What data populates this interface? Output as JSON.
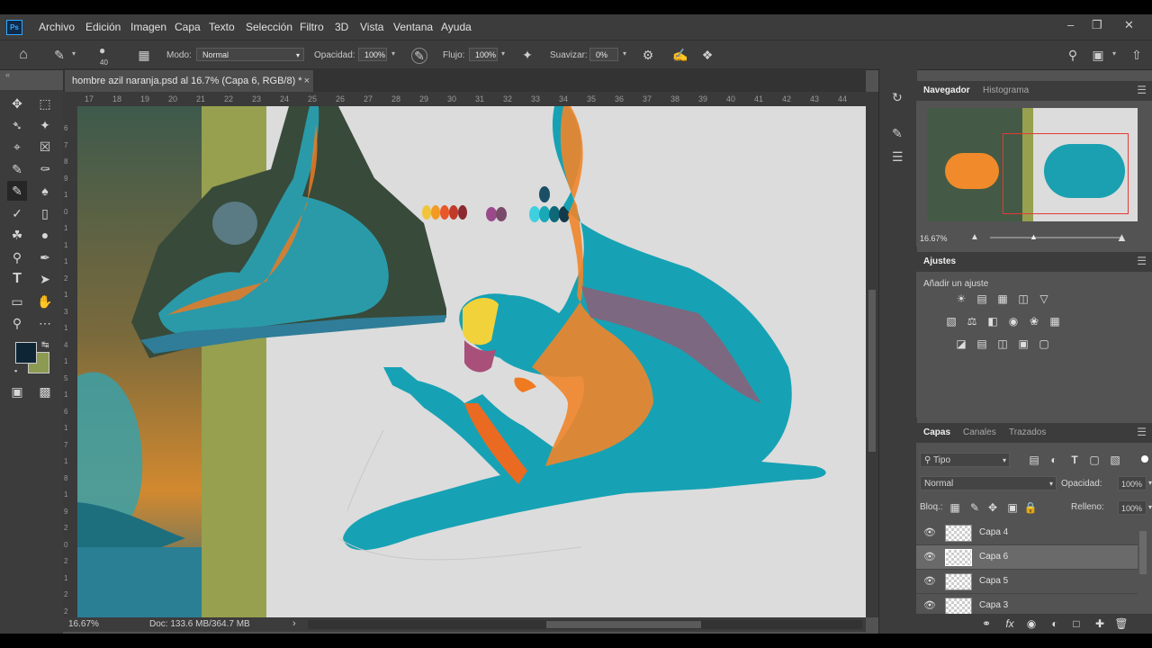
{
  "menubar": {
    "app_logo": "Ps",
    "items": [
      "Archivo",
      "Edición",
      "Imagen",
      "Capa",
      "Texto",
      "Selección",
      "Filtro",
      "3D",
      "Vista",
      "Ventana",
      "Ayuda"
    ]
  },
  "options": {
    "brush_size": "40",
    "mode_label": "Modo:",
    "mode_value": "Normal",
    "opacity_label": "Opacidad:",
    "opacity_value": "100%",
    "flow_label": "Flujo:",
    "flow_value": "100%",
    "smooth_label": "Suavizar:",
    "smooth_value": "0%"
  },
  "document": {
    "tab_title": "hombre azil naranja.psd al 16.7% (Capa 6, RGB/8) *",
    "close_glyph": "×",
    "ruler_h": [
      "17",
      "18",
      "19",
      "20",
      "21",
      "22",
      "23",
      "24",
      "25",
      "26",
      "27",
      "28",
      "29",
      "30",
      "31",
      "32",
      "33",
      "34",
      "35",
      "36",
      "37",
      "38",
      "39",
      "40",
      "41",
      "42",
      "43",
      "44"
    ],
    "ruler_v": [
      "6",
      "7",
      "8",
      "9",
      "1",
      "0",
      "1",
      "1",
      "1",
      "2",
      "1",
      "3",
      "1",
      "4",
      "1",
      "5",
      "1",
      "6",
      "1",
      "7",
      "1",
      "8",
      "1",
      "9",
      "2",
      "0",
      "2",
      "1",
      "2",
      "2"
    ]
  },
  "status": {
    "zoom": "16.67%",
    "doc_info": "Doc: 133.6 MB/364.7 MB",
    "arrow": "›"
  },
  "navigator": {
    "tab_active": "Navegador",
    "tab_inactive": "Histograma",
    "zoom": "16.67%"
  },
  "adjustments": {
    "title": "Ajustes",
    "add_label": "Añadir un ajuste"
  },
  "layers": {
    "tab_active": "Capas",
    "tab_channels": "Canales",
    "tab_paths": "Trazados",
    "filter_label": "Tipo",
    "blend_mode": "Normal",
    "opacity_label": "Opacidad:",
    "opacity_value": "100%",
    "lock_label": "Bloq.:",
    "fill_label": "Relleno:",
    "fill_value": "100%",
    "items": [
      {
        "name": "Capa 4",
        "selected": false
      },
      {
        "name": "Capa 6",
        "selected": true
      },
      {
        "name": "Capa 5",
        "selected": false
      },
      {
        "name": "Capa 3",
        "selected": false
      }
    ]
  },
  "colors": {
    "foreground": "#0e2536",
    "background": "#8c9a52",
    "teal": "#1aa0b0",
    "orange": "#f07a20",
    "accent_blue": "#31a8ff"
  }
}
